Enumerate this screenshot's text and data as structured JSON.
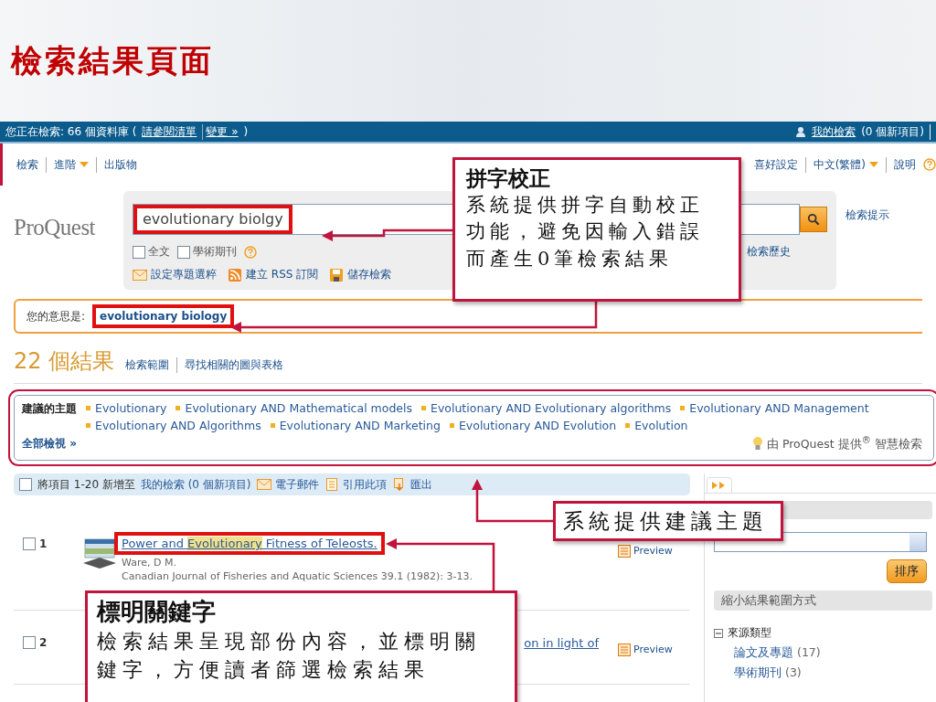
{
  "slide_title": "檢索結果頁面",
  "top_bar": {
    "prefix": "您正在檢索: 66 個資料庫 (",
    "links": [
      "請參閱清單",
      "變更 »"
    ],
    "suffix": ")",
    "my_search": "我的檢索",
    "my_search_count": "(0 個新項目)"
  },
  "nav": {
    "left": [
      {
        "label": "檢索",
        "dropdown": false
      },
      {
        "label": "進階",
        "dropdown": true
      },
      {
        "label": "出版物",
        "dropdown": false
      }
    ],
    "right": [
      {
        "label": "喜好設定",
        "dropdown": false
      },
      {
        "label": "中文(繁體)",
        "dropdown": true
      },
      {
        "label": "說明",
        "dropdown": false
      }
    ]
  },
  "logo": "ProQuest",
  "search": {
    "value": "evolutionary biolgy",
    "options": [
      {
        "label": "全文",
        "checked": false
      },
      {
        "label": "學術期刊",
        "checked": false
      }
    ],
    "links": [
      {
        "kind": "mail",
        "label": "設定專題選粹"
      },
      {
        "kind": "rss",
        "label": "建立 RSS 訂閱"
      },
      {
        "kind": "save",
        "label": "儲存檢索"
      }
    ],
    "history": "檢索歷史",
    "tips": "檢索提示"
  },
  "did_you_mean": {
    "label": "您的意思是:",
    "suggestion": "evolutionary biology"
  },
  "results_header": {
    "count": "22 個結果",
    "links": [
      "檢索範圍",
      "尋找相關的圖與表格"
    ]
  },
  "suggested_topics": {
    "label": "建議的主題",
    "items": [
      "Evolutionary",
      "Evolutionary AND Mathematical models",
      "Evolutionary AND Evolutionary algorithms",
      "Evolutionary AND Management",
      "Evolutionary AND Algorithms",
      "Evolutionary AND Marketing",
      "Evolutionary AND Evolution",
      "Evolution"
    ],
    "view_all": "全部檢視 »",
    "credit": "由 ProQuest 提供$^{®}$ 智慧檢索"
  },
  "toolbar": {
    "checked": false,
    "text": "將項目 1-20 新增至",
    "link": "我的檢索 (0 個新項目)",
    "actions": [
      {
        "kind": "mail",
        "label": "電子郵件"
      },
      {
        "kind": "cite",
        "label": "引用此項"
      },
      {
        "kind": "export",
        "label": "匯出"
      }
    ]
  },
  "results": [
    {
      "number": "1",
      "checked": false,
      "cut": false,
      "title": [
        {
          "text": "Power and ",
          "highlight": false
        },
        {
          "text": "Evolutionary",
          "highlight": true
        },
        {
          "text": " Fitness of Teleosts.",
          "highlight": false
        }
      ],
      "author": "Ware, D M.",
      "source": "Canadian Journal of Fisheries and Aquatic Sciences 39.1 (1982): 3-13.",
      "preview": "Preview"
    },
    {
      "number": "2",
      "checked": false,
      "cut": true,
      "title": [
        {
          "text": "on in light of",
          "highlight": false
        }
      ],
      "preview": "Preview"
    }
  ],
  "sidebar": {
    "sort_button": "排序",
    "refine_header": "縮小結果範圍方式",
    "facets": [
      {
        "label": "來源類型",
        "expanded": true,
        "children": [
          {
            "label": "論文及專題",
            "count": "(17)"
          },
          {
            "label": "學術期刊",
            "count": "(3)"
          }
        ]
      }
    ]
  },
  "callouts": [
    {
      "title": "拼字校正",
      "body": "系統提供拼字自動校正功能，避免因輸入錯誤而產生0筆檢索結果"
    },
    {
      "body": "系統提供建議主題"
    },
    {
      "title": "標明關鍵字",
      "body": "檢索結果呈現部份內容，並標明關鍵字，方便讀者篩選檢索結果"
    }
  ]
}
